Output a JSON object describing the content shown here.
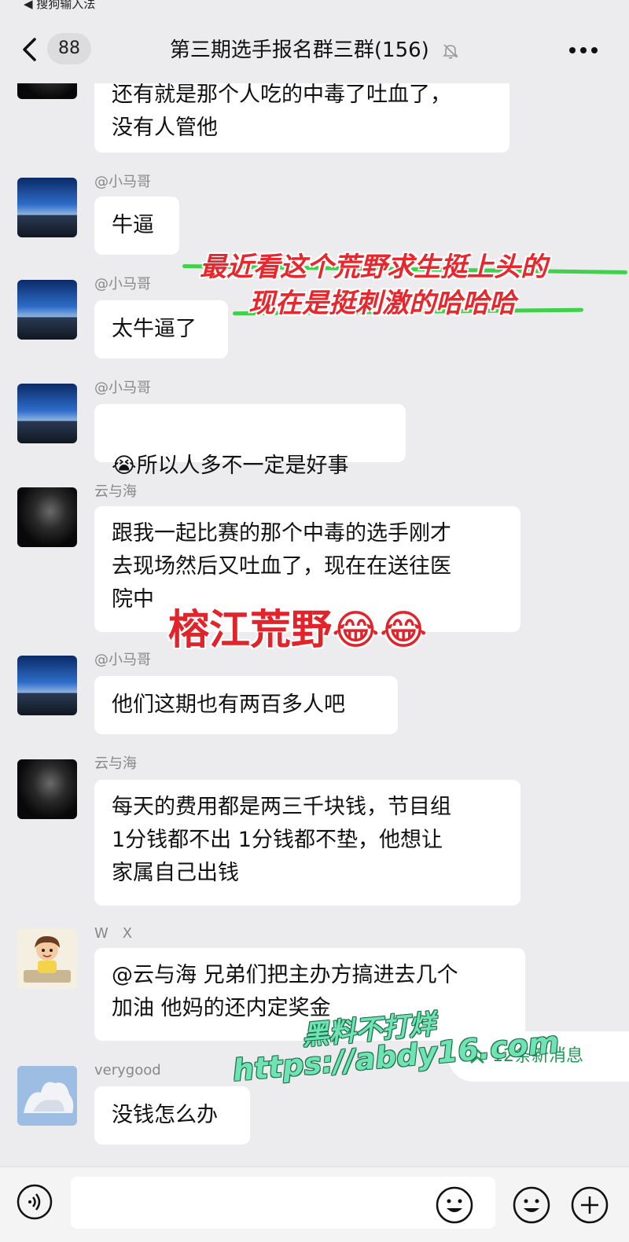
{
  "status": {
    "text": "◀ 搜狗输入法"
  },
  "header": {
    "back_count": "88",
    "title": "第三期选手报名群三群(156)"
  },
  "messages": [
    {
      "sender": "",
      "text": "还有就是那个人吃的中毒了吐血了，\n没有人管他",
      "avatar": "dark"
    },
    {
      "sender": "@小马哥",
      "text": "牛逼",
      "avatar": "sky"
    },
    {
      "sender": "@小马哥",
      "text": "太牛逼了",
      "avatar": "sky"
    },
    {
      "sender": "@小马哥",
      "text": "所以人多不一定是好事",
      "avatar": "sky",
      "emoji": "😭"
    },
    {
      "sender": "云与海",
      "text": "跟我一起比赛的那个中毒的选手刚才\n去现场然后又吐血了，现在在送往医\n院中",
      "avatar": "dark"
    },
    {
      "sender": "@小马哥",
      "text": "他们这期也有两百多人吧",
      "avatar": "sky"
    },
    {
      "sender": "云与海",
      "text": "每天的费用都是两三千块钱，节目组\n1分钱都不出 1分钱都不垫，他想让\n家属自己出钱",
      "avatar": "dark"
    },
    {
      "sender": "W　X",
      "text": "@云与海 兄弟们把主办方搞进去几个\n加油  他妈的还内定奖金",
      "avatar": "cartoon"
    },
    {
      "sender": "verygood",
      "text": "没钱怎么办",
      "avatar": "cloud"
    }
  ],
  "overlays": {
    "caption_line1": "最近看这个荒野求生挺上头的",
    "caption_line2": "现在是挺刺激的哈哈哈",
    "big_title": "榕江荒野😂😂",
    "watermark_line1": "黑料不打烊",
    "watermark_line2": "https://abdy16.com"
  },
  "new_messages": "12条新消息",
  "colors": {
    "background": "#ececee",
    "bubble": "#ffffff",
    "accent_green": "#1f9a55",
    "overlay_red": "#e8262b",
    "watermark_green": "#6fe3b2"
  },
  "icons": [
    "back-chevron-icon",
    "mute-bell-icon",
    "more-dots-icon",
    "voice-icon",
    "emoji-icon",
    "plus-icon",
    "double-chevron-up-icon"
  ]
}
